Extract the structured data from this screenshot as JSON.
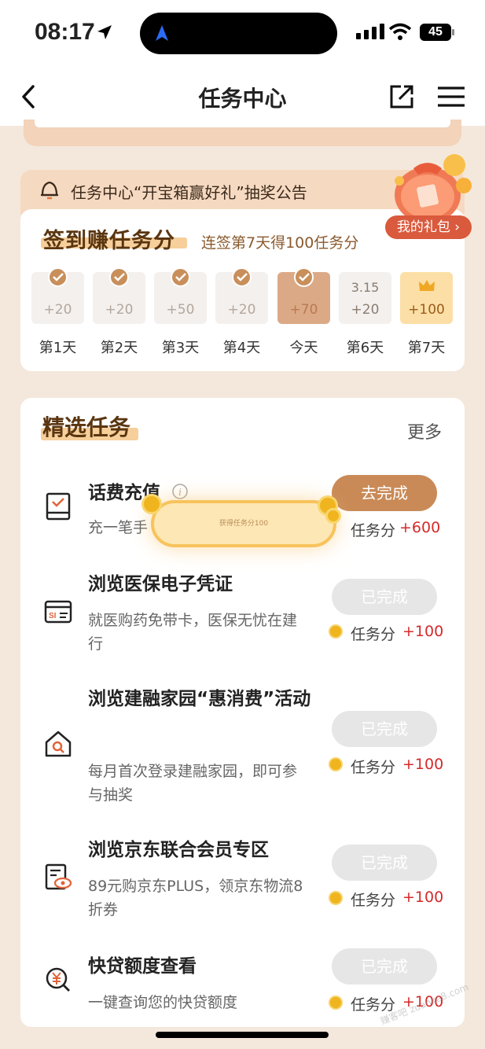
{
  "status_bar": {
    "time": "08:17",
    "battery": "45"
  },
  "nav": {
    "title": "任务中心"
  },
  "announcement": {
    "text": "任务中心“开宝箱赢好礼”抽奖公告"
  },
  "gift": {
    "label": "我的礼包 ›"
  },
  "checkin": {
    "title": "签到赚任务分",
    "subtitle": "连签第7天得100任务分",
    "days": [
      {
        "label": "第1天",
        "points": "+20",
        "state": "done"
      },
      {
        "label": "第2天",
        "points": "+20",
        "state": "done"
      },
      {
        "label": "第3天",
        "points": "+50",
        "state": "done"
      },
      {
        "label": "第4天",
        "points": "+20",
        "state": "done"
      },
      {
        "label": "今天",
        "points": "+70",
        "state": "today"
      },
      {
        "label": "第6天",
        "points": "+20",
        "date": "3.15",
        "state": "future"
      },
      {
        "label": "第7天",
        "points": "+100",
        "state": "bonus"
      }
    ]
  },
  "tasks": {
    "title": "精选任务",
    "more": "更多",
    "reward_label": "任务分",
    "items": [
      {
        "name": "话费充值",
        "desc": "充一笔手",
        "button": "去完成",
        "button_state": "active",
        "reward": "+600",
        "icon": "phone-bill-icon"
      },
      {
        "name": "浏览医保电子凭证",
        "desc": "就医购药免带卡，医保无忧在建行",
        "button": "已完成",
        "button_state": "done",
        "reward": "+100",
        "icon": "medical-card-icon"
      },
      {
        "name": "浏览建融家园“惠消费”活动",
        "desc": "每月首次登录建融家园，即可参与抽奖",
        "button": "已完成",
        "button_state": "done",
        "reward": "+100",
        "icon": "home-search-icon"
      },
      {
        "name": "浏览京东联合会员专区",
        "desc": "89元购京东PLUS，领京东物流8折券",
        "button": "已完成",
        "button_state": "done",
        "reward": "+100",
        "icon": "document-eye-icon"
      },
      {
        "name": "快贷额度查看",
        "desc": "一键查询您的快贷额度",
        "button": "已完成",
        "button_state": "done",
        "reward": "+100",
        "icon": "yuan-search-icon"
      }
    ]
  },
  "toast": {
    "text": "获得任务分100"
  },
  "watermark": "赚客吧 zuanke8.com"
}
